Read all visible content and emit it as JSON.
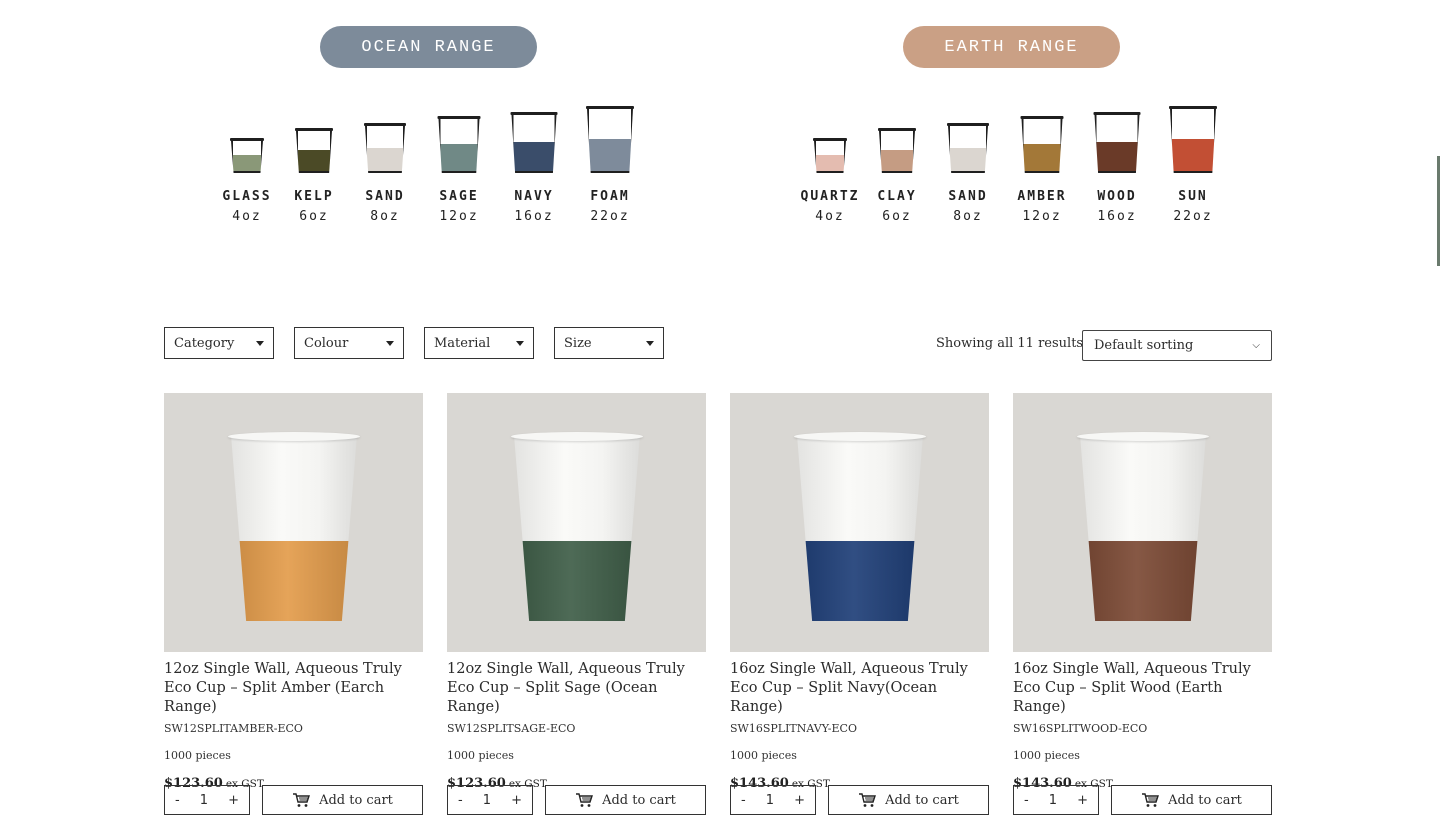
{
  "ranges": [
    {
      "title": "OCEAN RANGE",
      "color": "#7d8b9a",
      "cups": [
        {
          "name": "GLASS",
          "size": "4oz",
          "fill_color": "#8a9878"
        },
        {
          "name": "KELP",
          "size": "6oz",
          "fill_color": "#4b4a26"
        },
        {
          "name": "SAND",
          "size": "8oz",
          "fill_color": "#dbd6d0"
        },
        {
          "name": "SAGE",
          "size": "12oz",
          "fill_color": "#708986"
        },
        {
          "name": "NAVY",
          "size": "16oz",
          "fill_color": "#3a4d6a"
        },
        {
          "name": "FOAM",
          "size": "22oz",
          "fill_color": "#7e8b9b"
        }
      ]
    },
    {
      "title": "EARTH RANGE",
      "color": "#caa085",
      "cups": [
        {
          "name": "QUARTZ",
          "size": "4oz",
          "fill_color": "#e4bcb0"
        },
        {
          "name": "CLAY",
          "size": "6oz",
          "fill_color": "#c59c83"
        },
        {
          "name": "SAND",
          "size": "8oz",
          "fill_color": "#dbd6d0"
        },
        {
          "name": "AMBER",
          "size": "12oz",
          "fill_color": "#a37838"
        },
        {
          "name": "WOOD",
          "size": "16oz",
          "fill_color": "#6a3a28"
        },
        {
          "name": "SUN",
          "size": "22oz",
          "fill_color": "#c24f34"
        }
      ]
    }
  ],
  "filters": [
    "Category",
    "Colour",
    "Material",
    "Size"
  ],
  "results_text": "Showing all 11 results",
  "sorting": "Default sorting",
  "products": [
    {
      "title": "12oz Single Wall, Aqueous Truly Eco Cup – Split Amber (Earch Range)",
      "sku": "SW12SPLITAMBER-ECO",
      "pieces": "1000 pieces",
      "price": "$123.60",
      "gst": "ex GST",
      "qty": "1",
      "button": "Add to cart",
      "band_color": "#e39c4b"
    },
    {
      "title": "12oz Single Wall, Aqueous Truly Eco Cup – Split Sage (Ocean Range)",
      "sku": "SW12SPLITSAGE-ECO",
      "pieces": "1000 pieces",
      "price": "$123.60",
      "gst": "ex GST",
      "qty": "1",
      "button": "Add to cart",
      "band_color": "#3f5e48"
    },
    {
      "title": "16oz Single Wall, Aqueous Truly Eco Cup – Split Navy(Ocean Range)",
      "sku": "SW16SPLITNAVY-ECO",
      "pieces": "1000 pieces",
      "price": "$143.60",
      "gst": "ex GST",
      "qty": "1",
      "button": "Add to cart",
      "band_color": "#1f3f78"
    },
    {
      "title": "16oz Single Wall, Aqueous Truly Eco Cup – Split Wood (Earth Range)",
      "sku": "SW16SPLITWOOD-ECO",
      "pieces": "1000 pieces",
      "price": "$143.60",
      "gst": "ex GST",
      "qty": "1",
      "button": "Add to cart",
      "band_color": "#7c4a35"
    }
  ]
}
